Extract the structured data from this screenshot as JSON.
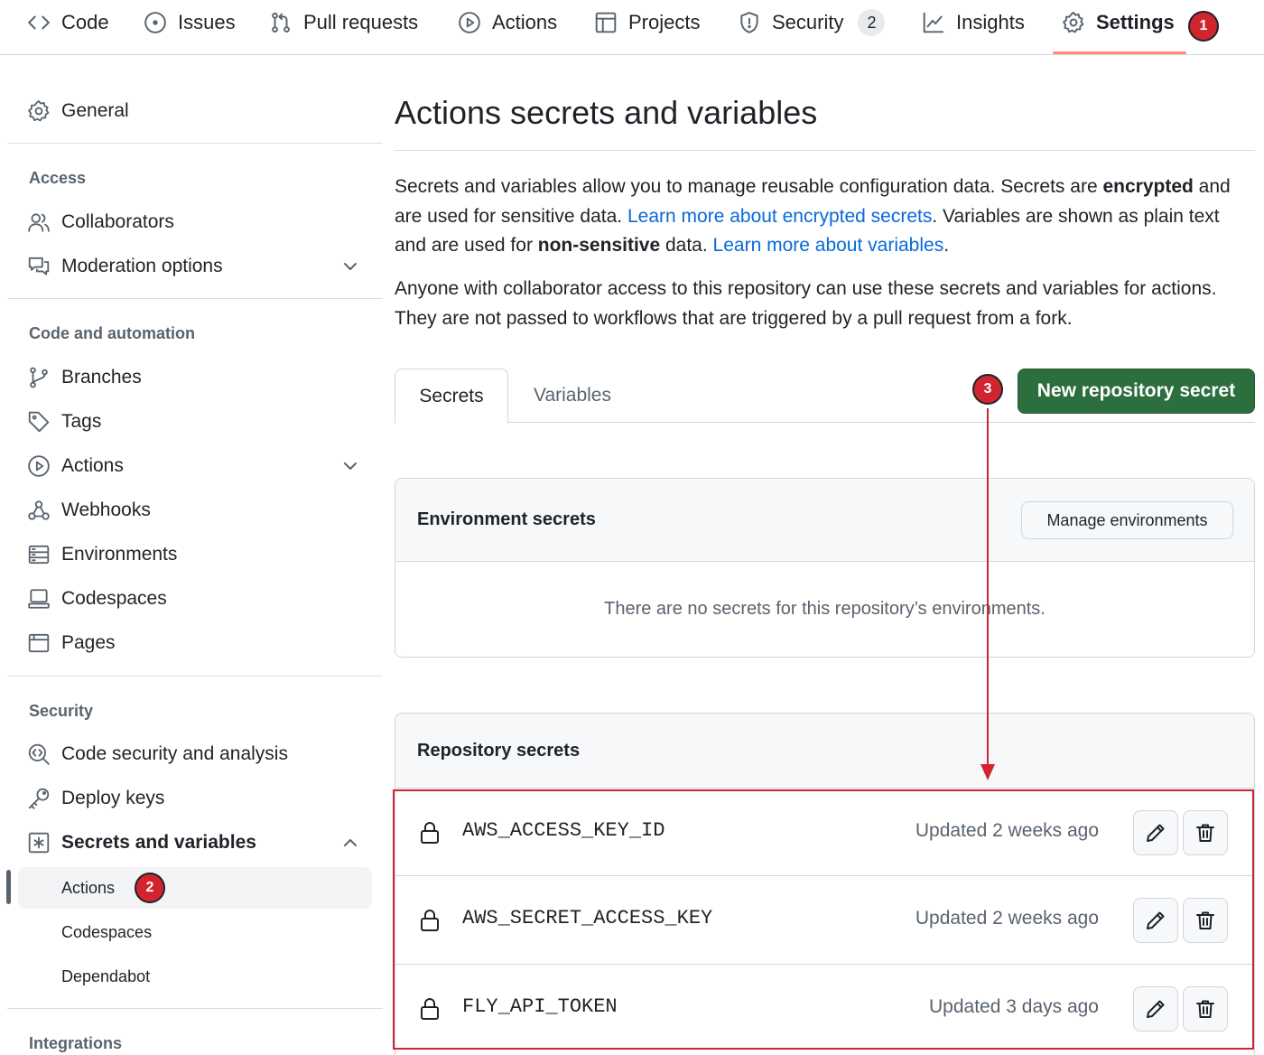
{
  "topnav": {
    "items": [
      {
        "label": "Code",
        "icon": "code-icon"
      },
      {
        "label": "Issues",
        "icon": "issue-opened-icon"
      },
      {
        "label": "Pull requests",
        "icon": "git-pull-request-icon"
      },
      {
        "label": "Actions",
        "icon": "play-icon"
      },
      {
        "label": "Projects",
        "icon": "table-icon"
      },
      {
        "label": "Security",
        "icon": "shield-icon",
        "counter": "2"
      },
      {
        "label": "Insights",
        "icon": "graph-icon"
      },
      {
        "label": "Settings",
        "icon": "gear-icon",
        "active": true
      }
    ]
  },
  "markers": [
    "1",
    "2",
    "3"
  ],
  "sidebar": {
    "general": "General",
    "sections": [
      {
        "heading": "Access",
        "items": [
          "Collaborators",
          "Moderation options"
        ]
      },
      {
        "heading": "Code and automation",
        "items": [
          "Branches",
          "Tags",
          "Actions",
          "Webhooks",
          "Environments",
          "Codespaces",
          "Pages"
        ]
      },
      {
        "heading": "Security",
        "items": [
          "Code security and analysis",
          "Deploy keys",
          "Secrets and variables"
        ]
      },
      {
        "heading": "Integrations",
        "items": []
      }
    ],
    "secrets_subitems": [
      "Actions",
      "Codespaces",
      "Dependabot"
    ]
  },
  "main": {
    "title": "Actions secrets and variables",
    "intro": {
      "part1": "Secrets and variables allow you to manage reusable configuration data. Secrets are ",
      "bold1": "encrypted",
      "part2": " and are used for sensitive data. ",
      "link1": "Learn more about encrypted secrets",
      "part3": ". Variables are shown as plain text and are used for ",
      "bold2": "non-sensitive",
      "part4": " data. ",
      "link2": "Learn more about variables",
      "part5": "."
    },
    "access_note": "Anyone with collaborator access to this repository can use these secrets and variables for actions. They are not passed to workflows that are triggered by a pull request from a fork.",
    "tabs": [
      "Secrets",
      "Variables"
    ],
    "new_secret_button": "New repository secret",
    "env_secrets": {
      "title": "Environment secrets",
      "manage_button": "Manage environments",
      "empty": "There are no secrets for this repository’s environments."
    },
    "repo_secrets": {
      "title": "Repository secrets",
      "rows": [
        {
          "name": "AWS_ACCESS_KEY_ID",
          "updated": "Updated 2 weeks ago"
        },
        {
          "name": "AWS_SECRET_ACCESS_KEY",
          "updated": "Updated 2 weeks ago"
        },
        {
          "name": "FLY_API_TOKEN",
          "updated": "Updated 3 days ago"
        }
      ]
    }
  },
  "colors": {
    "accent_link": "#0969da",
    "primary_button": "#2c6e3d",
    "annotation_red": "#d1242f",
    "settings_underline": "#fd8c73"
  }
}
